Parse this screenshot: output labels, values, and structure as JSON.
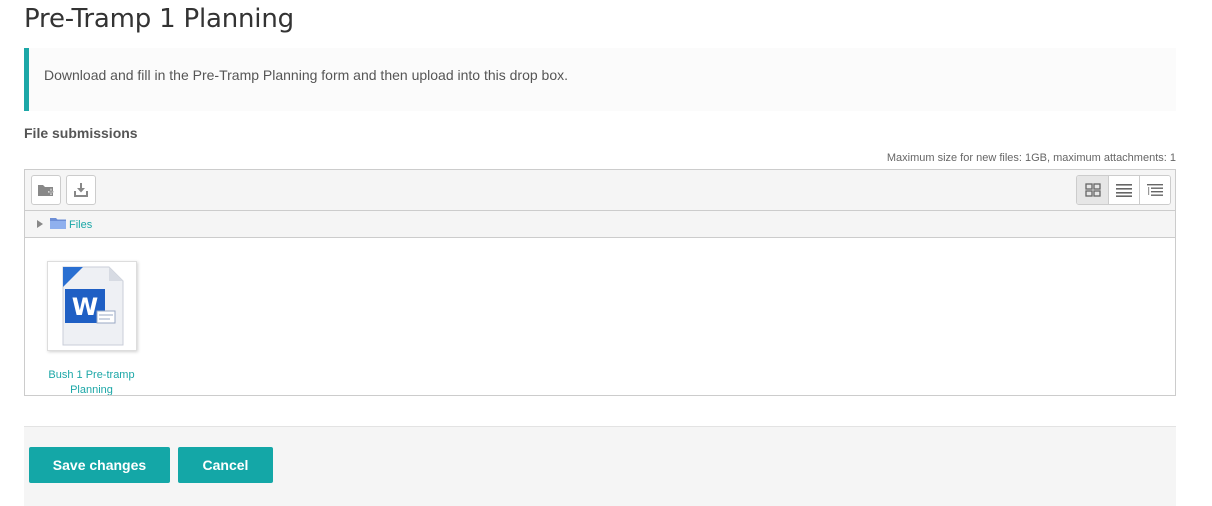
{
  "page": {
    "title": "Pre-Tramp 1 Planning"
  },
  "intro": {
    "text": "Download and fill in the Pre-Tramp Planning form and then upload into this drop box."
  },
  "submissions": {
    "label": "File submissions",
    "max_size_note": "Maximum size for new files: 1GB, maximum attachments: 1"
  },
  "filemanager": {
    "toolbar": {
      "add_icon": "add-folder-icon",
      "download_icon": "download-icon",
      "views": [
        "icons-view-icon",
        "list-view-icon",
        "tree-view-icon"
      ]
    },
    "path": {
      "label": "Files"
    },
    "files": [
      {
        "name": "Bush 1 Pre-tramp Planning",
        "icon": "word-document-icon"
      }
    ]
  },
  "actions": {
    "save_label": "Save changes",
    "cancel_label": "Cancel"
  },
  "colors": {
    "accent": "#14a7a7",
    "link": "#1ca7a7"
  }
}
